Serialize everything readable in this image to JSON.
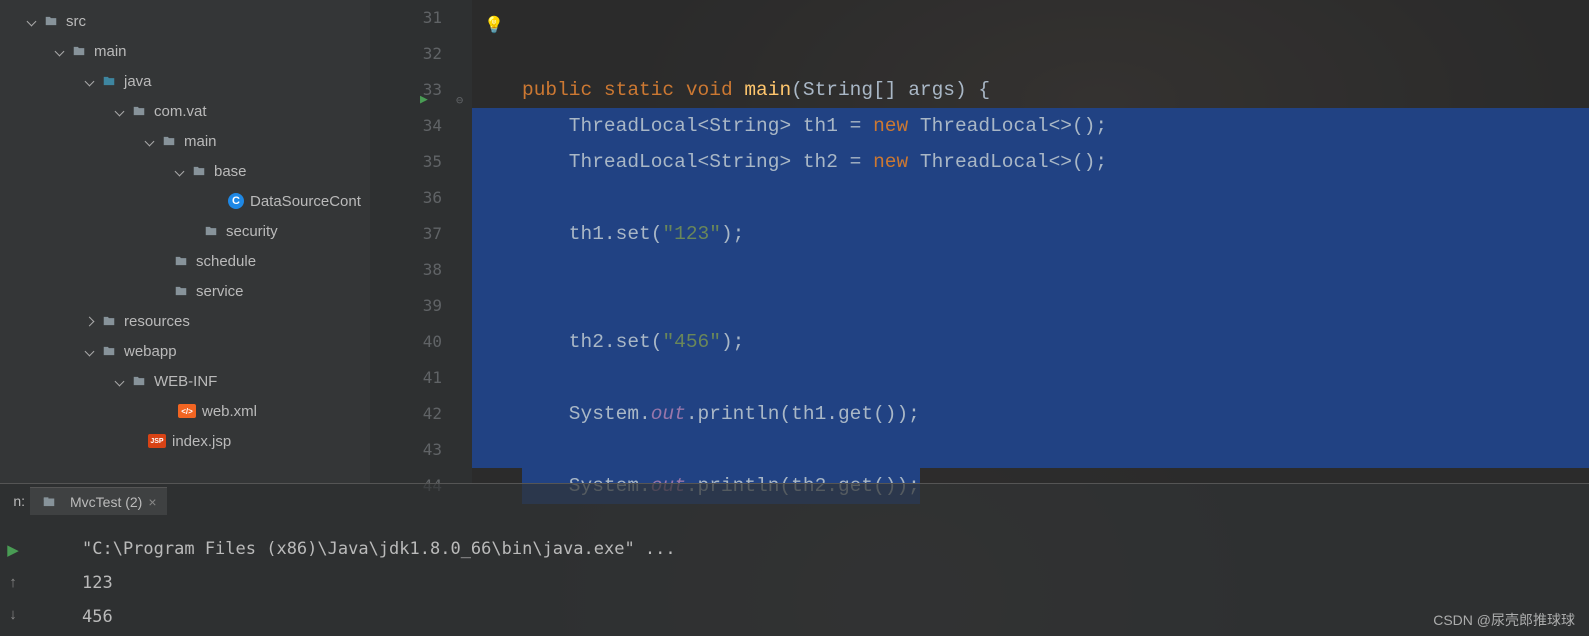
{
  "sidebar": {
    "tree": [
      {
        "indent": 20,
        "icon": "folder",
        "label": "src",
        "chev": "down",
        "open": true
      },
      {
        "indent": 48,
        "icon": "folder",
        "label": "main",
        "chev": "down",
        "open": true
      },
      {
        "indent": 78,
        "icon": "folder-src",
        "label": "java",
        "chev": "down",
        "open": true
      },
      {
        "indent": 108,
        "icon": "folder",
        "label": "com.vat",
        "chev": "down",
        "open": true
      },
      {
        "indent": 138,
        "icon": "folder",
        "label": "main",
        "chev": "down",
        "open": true
      },
      {
        "indent": 168,
        "icon": "folder",
        "label": "base",
        "chev": "down",
        "open": true
      },
      {
        "indent": 206,
        "icon": "class",
        "label": "DataSourceCont",
        "chev": ""
      },
      {
        "indent": 180,
        "icon": "folder",
        "label": "security",
        "chev": ""
      },
      {
        "indent": 150,
        "icon": "folder",
        "label": "schedule",
        "chev": ""
      },
      {
        "indent": 150,
        "icon": "folder",
        "label": "service",
        "chev": ""
      },
      {
        "indent": 78,
        "icon": "folder",
        "label": "resources",
        "chev": "right",
        "open": false
      },
      {
        "indent": 78,
        "icon": "folder",
        "label": "webapp",
        "chev": "down",
        "open": true
      },
      {
        "indent": 108,
        "icon": "folder",
        "label": "WEB-INF",
        "chev": "down",
        "open": true
      },
      {
        "indent": 156,
        "icon": "xml",
        "label": "web.xml",
        "chev": ""
      },
      {
        "indent": 126,
        "icon": "jsp",
        "label": "index.jsp",
        "chev": ""
      }
    ]
  },
  "editor": {
    "gutterStart": 31,
    "lines": [
      {
        "n": 31,
        "selected": false,
        "tokens": []
      },
      {
        "n": 32,
        "selected": false,
        "tokens": []
      },
      {
        "n": 33,
        "selected": false,
        "run": true,
        "fold": true,
        "tokens": [
          {
            "t": "kw",
            "s": "public "
          },
          {
            "t": "kw",
            "s": "static "
          },
          {
            "t": "kw",
            "s": "void "
          },
          {
            "t": "fn",
            "s": "main"
          },
          {
            "t": "plain",
            "s": "(String[] args) {"
          }
        ]
      },
      {
        "n": 34,
        "selected": true,
        "tokens": [
          {
            "t": "plain",
            "s": "    ThreadLocal<String> th1 = "
          },
          {
            "t": "kw",
            "s": "new "
          },
          {
            "t": "plain",
            "s": "ThreadLocal<>();"
          }
        ]
      },
      {
        "n": 35,
        "selected": true,
        "tokens": [
          {
            "t": "plain",
            "s": "    ThreadLocal<String> th2 = "
          },
          {
            "t": "kw",
            "s": "new "
          },
          {
            "t": "plain",
            "s": "ThreadLocal<>();"
          }
        ]
      },
      {
        "n": 36,
        "selected": true,
        "tokens": []
      },
      {
        "n": 37,
        "selected": true,
        "tokens": [
          {
            "t": "plain",
            "s": "    th1.set("
          },
          {
            "t": "str",
            "s": "\"123\""
          },
          {
            "t": "plain",
            "s": ");"
          }
        ]
      },
      {
        "n": 38,
        "selected": true,
        "tokens": []
      },
      {
        "n": 39,
        "selected": true,
        "tokens": []
      },
      {
        "n": 40,
        "selected": true,
        "tokens": [
          {
            "t": "plain",
            "s": "    th2.set("
          },
          {
            "t": "str",
            "s": "\"456\""
          },
          {
            "t": "plain",
            "s": ");"
          }
        ]
      },
      {
        "n": 41,
        "selected": true,
        "tokens": []
      },
      {
        "n": 42,
        "selected": true,
        "tokens": [
          {
            "t": "plain",
            "s": "    System."
          },
          {
            "t": "field",
            "s": "out"
          },
          {
            "t": "plain",
            "s": ".println(th1.get());"
          }
        ]
      },
      {
        "n": 43,
        "selected": true,
        "tokens": []
      },
      {
        "n": 44,
        "selected": true,
        "bulb": true,
        "tokens": [
          {
            "t": "plain",
            "s": "    System."
          },
          {
            "t": "field",
            "s": "out"
          },
          {
            "t": "plain",
            "s": ".println(th2.get());"
          }
        ]
      }
    ]
  },
  "panel": {
    "prefix": "n:",
    "tab": "MvcTest (2)",
    "console": [
      "\"C:\\Program Files (x86)\\Java\\jdk1.8.0_66\\bin\\java.exe\" ...",
      "123",
      "456"
    ]
  },
  "watermark": "CSDN @尿壳郎推球球"
}
